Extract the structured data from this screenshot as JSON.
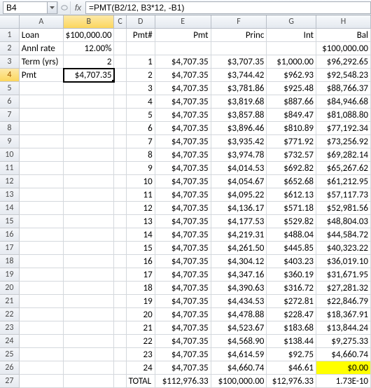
{
  "namebox": {
    "value": "B4"
  },
  "formula": {
    "value": "=PMT(B2/12, B3*12, -B1)"
  },
  "colHeaders": [
    "A",
    "B",
    "C",
    "D",
    "E",
    "F",
    "G",
    "H"
  ],
  "leftLabels": {
    "r1a": "Loan",
    "r1b": "$100,000.00",
    "r2a": "Annl rate",
    "r2b": "12.00%",
    "r3a": "Term (yrs)",
    "r3b": "2",
    "r4a": "Pmt",
    "r4b": "$4,707.35"
  },
  "tableHeader": {
    "d": "Pmt#",
    "e": "Pmt",
    "f": "Princ",
    "g": "Int",
    "h": "Bal"
  },
  "row2h": "$100,000.00",
  "rows": [
    {
      "n": "1",
      "pmt": "$4,707.35",
      "pr": "$3,707.35",
      "int": "$1,000.00",
      "bal": "$96,292.65"
    },
    {
      "n": "2",
      "pmt": "$4,707.35",
      "pr": "$3,744.42",
      "int": "$962.93",
      "bal": "$92,548.23"
    },
    {
      "n": "3",
      "pmt": "$4,707.35",
      "pr": "$3,781.86",
      "int": "$925.48",
      "bal": "$88,766.37"
    },
    {
      "n": "4",
      "pmt": "$4,707.35",
      "pr": "$3,819.68",
      "int": "$887.66",
      "bal": "$84,946.68"
    },
    {
      "n": "5",
      "pmt": "$4,707.35",
      "pr": "$3,857.88",
      "int": "$849.47",
      "bal": "$81,088.80"
    },
    {
      "n": "6",
      "pmt": "$4,707.35",
      "pr": "$3,896.46",
      "int": "$810.89",
      "bal": "$77,192.34"
    },
    {
      "n": "7",
      "pmt": "$4,707.35",
      "pr": "$3,935.42",
      "int": "$771.92",
      "bal": "$73,256.92"
    },
    {
      "n": "8",
      "pmt": "$4,707.35",
      "pr": "$3,974.78",
      "int": "$732.57",
      "bal": "$69,282.14"
    },
    {
      "n": "9",
      "pmt": "$4,707.35",
      "pr": "$4,014.53",
      "int": "$692.82",
      "bal": "$65,267.62"
    },
    {
      "n": "10",
      "pmt": "$4,707.35",
      "pr": "$4,054.67",
      "int": "$652.68",
      "bal": "$61,212.95"
    },
    {
      "n": "11",
      "pmt": "$4,707.35",
      "pr": "$4,095.22",
      "int": "$612.13",
      "bal": "$57,117.73"
    },
    {
      "n": "12",
      "pmt": "$4,707.35",
      "pr": "$4,136.17",
      "int": "$571.18",
      "bal": "$52,981.56"
    },
    {
      "n": "13",
      "pmt": "$4,707.35",
      "pr": "$4,177.53",
      "int": "$529.82",
      "bal": "$48,804.03"
    },
    {
      "n": "14",
      "pmt": "$4,707.35",
      "pr": "$4,219.31",
      "int": "$488.04",
      "bal": "$44,584.72"
    },
    {
      "n": "15",
      "pmt": "$4,707.35",
      "pr": "$4,261.50",
      "int": "$445.85",
      "bal": "$40,323.22"
    },
    {
      "n": "16",
      "pmt": "$4,707.35",
      "pr": "$4,304.12",
      "int": "$403.23",
      "bal": "$36,019.10"
    },
    {
      "n": "17",
      "pmt": "$4,707.35",
      "pr": "$4,347.16",
      "int": "$360.19",
      "bal": "$31,671.95"
    },
    {
      "n": "18",
      "pmt": "$4,707.35",
      "pr": "$4,390.63",
      "int": "$316.72",
      "bal": "$27,281.32"
    },
    {
      "n": "19",
      "pmt": "$4,707.35",
      "pr": "$4,434.53",
      "int": "$272.81",
      "bal": "$22,846.79"
    },
    {
      "n": "20",
      "pmt": "$4,707.35",
      "pr": "$4,478.88",
      "int": "$228.47",
      "bal": "$18,367.91"
    },
    {
      "n": "21",
      "pmt": "$4,707.35",
      "pr": "$4,523.67",
      "int": "$183.68",
      "bal": "$13,844.24"
    },
    {
      "n": "22",
      "pmt": "$4,707.35",
      "pr": "$4,568.90",
      "int": "$138.44",
      "bal": "$9,275.33"
    },
    {
      "n": "23",
      "pmt": "$4,707.35",
      "pr": "$4,614.59",
      "int": "$92.75",
      "bal": "$4,660.74"
    },
    {
      "n": "24",
      "pmt": "$4,707.35",
      "pr": "$4,660.74",
      "int": "$46.61",
      "bal": "$0.00"
    }
  ],
  "total": {
    "label": "TOTAL",
    "pmt": "$112,976.33",
    "pr": "$100,000.00",
    "int": "$12,976.33",
    "bal": "1.73E-10"
  }
}
